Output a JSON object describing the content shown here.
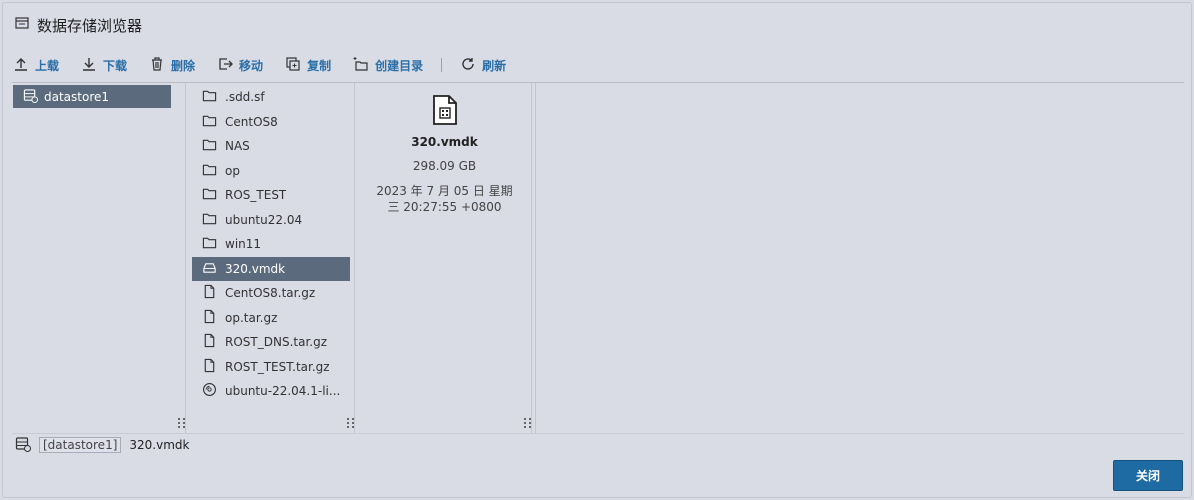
{
  "window": {
    "title": "数据存储浏览器"
  },
  "toolbar": {
    "upload": "上载",
    "download": "下载",
    "delete": "删除",
    "move": "移动",
    "copy": "复制",
    "create_dir": "创建目录",
    "refresh": "刷新"
  },
  "datastores": [
    {
      "label": "datastore1",
      "selected": true
    }
  ],
  "files": [
    {
      "name": ".sdd.sf",
      "icon": "folder-icon"
    },
    {
      "name": "CentOS8",
      "icon": "folder-icon"
    },
    {
      "name": "NAS",
      "icon": "folder-icon"
    },
    {
      "name": "op",
      "icon": "folder-icon"
    },
    {
      "name": "ROS_TEST",
      "icon": "folder-icon"
    },
    {
      "name": "ubuntu22.04",
      "icon": "folder-icon"
    },
    {
      "name": "win11",
      "icon": "folder-icon"
    },
    {
      "name": "320.vmdk",
      "icon": "disk-icon",
      "selected": true
    },
    {
      "name": "CentOS8.tar.gz",
      "icon": "file-icon"
    },
    {
      "name": "op.tar.gz",
      "icon": "file-icon"
    },
    {
      "name": "ROST_DNS.tar.gz",
      "icon": "file-icon"
    },
    {
      "name": "ROST_TEST.tar.gz",
      "icon": "file-icon"
    },
    {
      "name": "ubuntu-22.04.1-li...",
      "icon": "cd-icon"
    }
  ],
  "details": {
    "name": "320.vmdk",
    "size": "298.09 GB",
    "date_line1": "2023 年 7 月 05 日 星期",
    "date_line2": "三 20:27:55 +0800"
  },
  "pathbar": {
    "datastore": "[datastore1]",
    "file": "320.vmdk"
  },
  "footer": {
    "close": "关闭"
  },
  "colors": {
    "accent": "#1e6aa3",
    "selected_row": "#5b6a7c",
    "toolbar_text": "#2a6fa8"
  }
}
